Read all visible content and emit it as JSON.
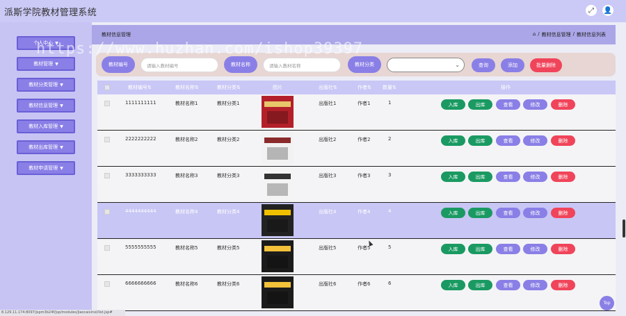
{
  "app": {
    "title": "派斯学院教材管理系统"
  },
  "topbar": {
    "icon1": "fullscreen-icon",
    "icon2": "user-icon"
  },
  "sidebar": {
    "items": [
      {
        "label": "个人中心"
      },
      {
        "label": "教材管理"
      },
      {
        "label": "教材分类管理"
      },
      {
        "label": "教材信息管理"
      },
      {
        "label": "教材入库管理"
      },
      {
        "label": "教材出库管理"
      },
      {
        "label": "教材申请管理"
      }
    ]
  },
  "breadcrumb": {
    "title": "教材信息管理",
    "path1": "教材信息管理",
    "sep": "/",
    "path2": "教材信息列表"
  },
  "search": {
    "label1": "教材编号",
    "placeholder1": "请输入教材编号",
    "label2": "教材名称",
    "placeholder2": "请输入教材名称",
    "label3": "教材分类",
    "query": "查询",
    "add": "添加",
    "batch_delete": "批量删除"
  },
  "table": {
    "headers": {
      "code": "教材编号",
      "name": "教材名称",
      "category": "教材分类",
      "image": "图片",
      "publisher": "出版社",
      "author": "作者",
      "qty": "数量",
      "ops": "操作"
    },
    "rows": [
      {
        "code": "1111111111",
        "name": "教材名称1",
        "category": "教材分类1",
        "publisher": "出版社1",
        "author": "作者1",
        "qty": "1"
      },
      {
        "code": "2222222222",
        "name": "教材名称2",
        "category": "教材分类2",
        "publisher": "出版社2",
        "author": "作者2",
        "qty": "2"
      },
      {
        "code": "3333333333",
        "name": "教材名称3",
        "category": "教材分类3",
        "publisher": "出版社3",
        "author": "作者3",
        "qty": "3"
      },
      {
        "code": "4444444444",
        "name": "教材名称4",
        "category": "教材分类4",
        "publisher": "出版社4",
        "author": "作者4",
        "qty": "4"
      },
      {
        "code": "5555555555",
        "name": "教材名称5",
        "category": "教材分类5",
        "publisher": "出版社5",
        "author": "作者5",
        "qty": "5"
      },
      {
        "code": "6666666666",
        "name": "教材名称6",
        "category": "教材分类6",
        "publisher": "出版社6",
        "author": "作者6",
        "qty": "6"
      }
    ],
    "actions": {
      "stock_in": "入库",
      "stock_out": "出库",
      "view": "查看",
      "edit": "修改",
      "delete": "删除"
    }
  },
  "watermark": "https://www.huzhan.com/ishop39397",
  "status_url": "8.129.11.174:8097/jspm3b24f/jsp/modules/jiaocaixinxi/list.jsp#",
  "top_button": "Top",
  "colors": {
    "accent": "#8a7fe6",
    "green": "#1a9a62",
    "red": "#f0445a",
    "sidebar": "#c7c4f4"
  }
}
